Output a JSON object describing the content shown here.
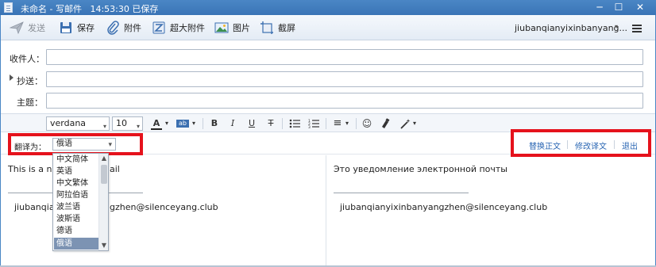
{
  "window": {
    "title": "未命名 - 写邮件",
    "saved_status": "14:53:30 已保存",
    "minimize_glyph": "─",
    "maximize_glyph": "☐",
    "close_glyph": "✕"
  },
  "toolbar": {
    "send": "发送",
    "save": "保存",
    "attach": "附件",
    "big_attach": "超大附件",
    "picture": "图片",
    "screenshot": "截屏",
    "account": "jiubanqianyixinbanyang...",
    "account_caret": "▾"
  },
  "fields": {
    "to_label": "收件人：",
    "cc_label": "抄送：",
    "subject_label": "主题：",
    "to_value": "",
    "cc_value": "",
    "subject_value": ""
  },
  "format": {
    "font_family": "verdana",
    "font_size": "10",
    "font_color_glyph": "A",
    "highlight_glyph": "ab",
    "bold": "B",
    "italic": "I",
    "underline": "U",
    "strike": "T",
    "align_glyph": "≡",
    "emoji_glyph": "☺",
    "caret": "▾"
  },
  "translate": {
    "label": "翻译为：",
    "selected_language": "俄语",
    "caret": "▾",
    "replace_body": "替换正文",
    "edit_translation": "修改译文",
    "exit": "退出",
    "options": [
      "中文简体",
      "英语",
      "中文繁体",
      "阿拉伯语",
      "波兰语",
      "波斯语",
      "德语",
      "俄语"
    ]
  },
  "original": {
    "line1_start": "This is a no",
    "line1_end": "ail",
    "signature_start": "jiubanqia",
    "signature_end": "gzhen@silenceyang.club"
  },
  "translated": {
    "line1": "Это уведомление электронной почты",
    "signature": "jiubanqianyixinbanyangzhen@silenceyang.club"
  },
  "colors": {
    "highlight_box": "#e5121c",
    "link": "#2a66b3",
    "titlebar": "#3a74b6"
  }
}
